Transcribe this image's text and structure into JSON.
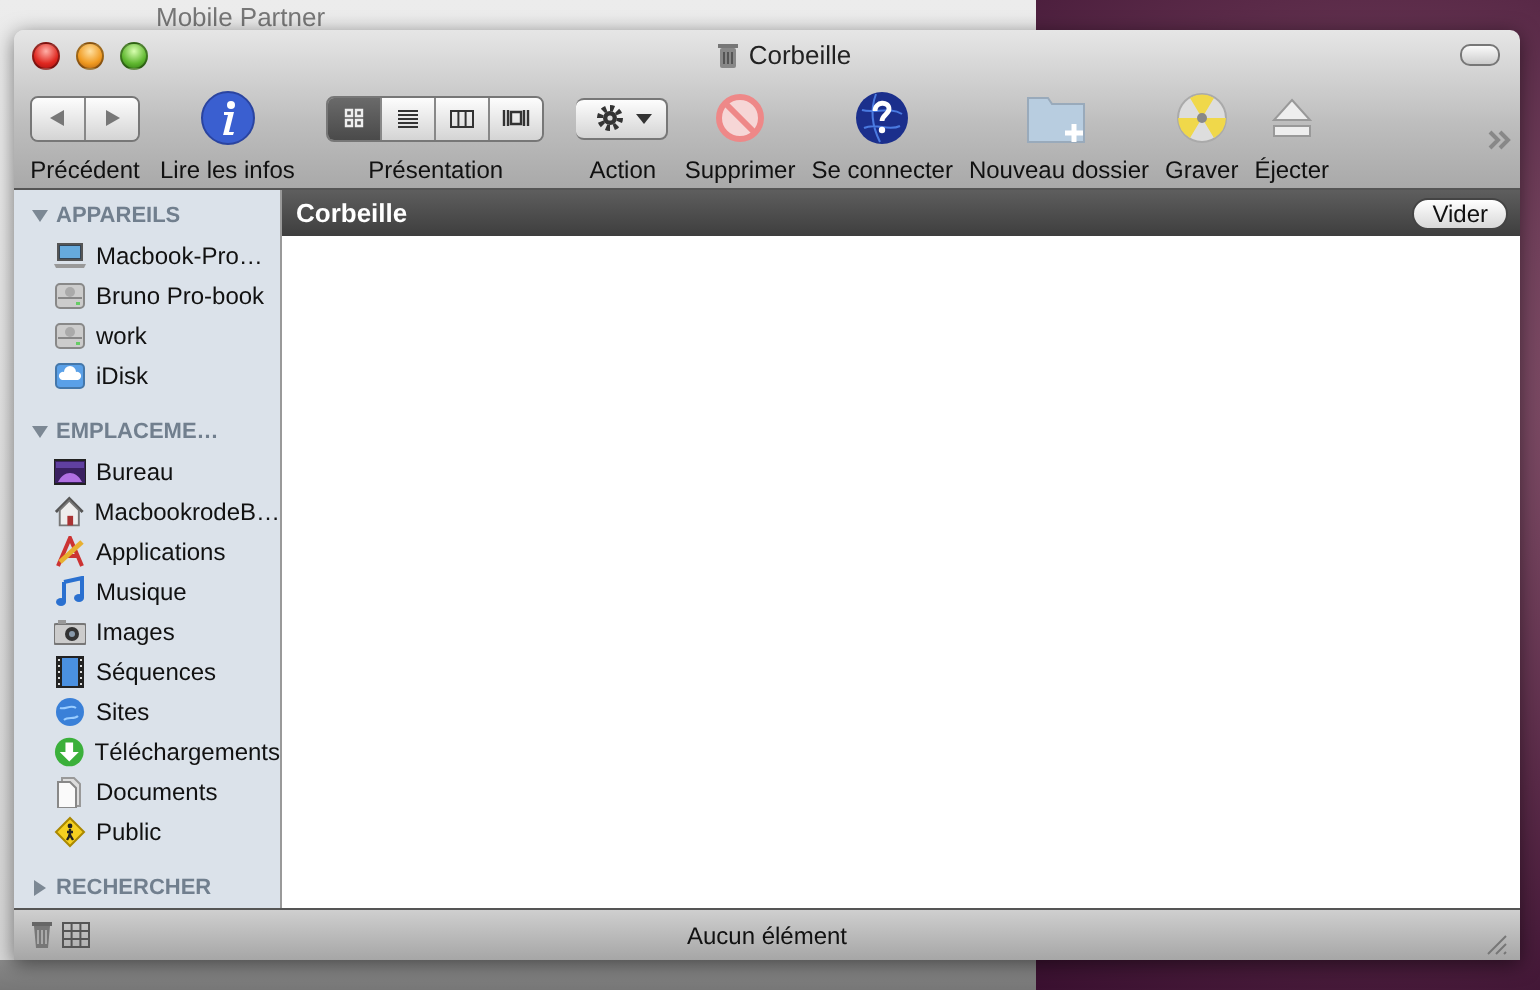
{
  "background_window": {
    "title": "Mobile Partner"
  },
  "window": {
    "title": "Corbeille"
  },
  "toolbar": {
    "items": [
      {
        "kind": "nav",
        "label": "Précédent"
      },
      {
        "kind": "info",
        "label": "Lire les infos"
      },
      {
        "kind": "views",
        "label": "Présentation",
        "views": [
          {
            "selected": true
          },
          {
            "selected": false
          },
          {
            "selected": false
          },
          {
            "selected": false
          }
        ]
      },
      {
        "kind": "action",
        "label": "Action"
      },
      {
        "kind": "delete",
        "label": "Supprimer"
      },
      {
        "kind": "connect",
        "label": "Se connecter"
      },
      {
        "kind": "newfolder",
        "label": "Nouveau dossier"
      },
      {
        "kind": "burn",
        "label": "Graver"
      },
      {
        "kind": "eject",
        "label": "Éjecter"
      }
    ]
  },
  "sidebar": {
    "sections": [
      {
        "title": "APPAREILS",
        "expanded": true,
        "items": [
          {
            "kind": "laptop",
            "label": "Macbook-Pro…"
          },
          {
            "kind": "disk",
            "label": "Bruno Pro-book"
          },
          {
            "kind": "disk",
            "label": "work"
          },
          {
            "kind": "idisk",
            "label": "iDisk"
          }
        ]
      },
      {
        "title": "EMPLACEME…",
        "expanded": true,
        "items": [
          {
            "kind": "desktop",
            "label": "Bureau"
          },
          {
            "kind": "home",
            "label": "MacbookrodeB…"
          },
          {
            "kind": "apps",
            "label": "Applications"
          },
          {
            "kind": "music",
            "label": "Musique"
          },
          {
            "kind": "pictures",
            "label": "Images"
          },
          {
            "kind": "movies",
            "label": "Séquences"
          },
          {
            "kind": "sites",
            "label": "Sites"
          },
          {
            "kind": "downloads",
            "label": "Téléchargements"
          },
          {
            "kind": "documents",
            "label": "Documents"
          },
          {
            "kind": "public",
            "label": "Public"
          }
        ]
      },
      {
        "title": "RECHERCHER",
        "expanded": false
      }
    ]
  },
  "path_bar": {
    "title": "Corbeille",
    "button": "Vider"
  },
  "status_bar": {
    "text": "Aucun élément"
  }
}
